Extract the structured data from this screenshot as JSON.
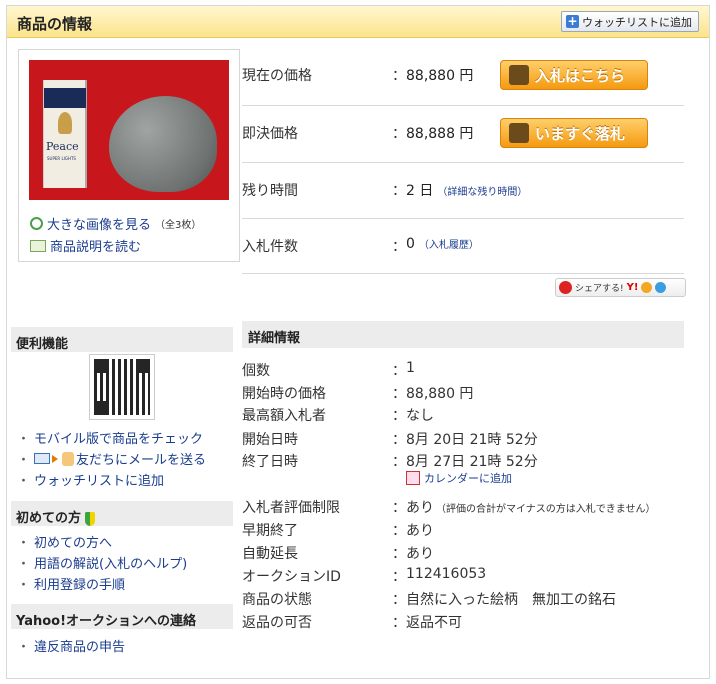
{
  "header": {
    "title": "商品の情報",
    "watch_button": "ウォッチリストに追加"
  },
  "image": {
    "pack_name": "Peace",
    "pack_sub": "SUPER LIGHTS",
    "view_large": "大きな画像を見る",
    "view_count": "（全3枚）",
    "read_description": "商品説明を読む"
  },
  "summary": {
    "current_price_label": "現在の価格",
    "current_price": "88,880 円",
    "bid_button": "入札はこちら",
    "buyout_label": "即決価格",
    "buyout_price": "88,888 円",
    "buyout_button": "いますぐ落札",
    "time_left_label": "残り時間",
    "time_left": "2 日",
    "time_left_link": "（詳細な残り時間）",
    "bids_label": "入札件数",
    "bids": "0",
    "bids_link": "（入札履歴）",
    "colon": "："
  },
  "share": {
    "label": "シェアする!",
    "yahoo": "Y!"
  },
  "sidebar": {
    "convenience_header": "便利機能",
    "convenience_items": [
      "モバイル版で商品をチェック",
      "友だちにメールを送る",
      "ウォッチリストに追加"
    ],
    "beginners_header": "初めての方",
    "beginners_items": [
      "初めての方へ",
      "用語の解説(入札のヘルプ)",
      "利用登録の手順"
    ],
    "contact_header": "Yahoo!オークションへの連絡",
    "contact_items": [
      "違反商品の申告"
    ],
    "bullet": "・"
  },
  "details": {
    "header": "詳細情報",
    "rows": [
      {
        "label": "個数",
        "value": "1"
      },
      {
        "label": "開始時の価格",
        "value": "88,880 円"
      },
      {
        "label": "最高額入札者",
        "value": "なし"
      },
      {
        "label": "開始日時",
        "value": "8月 20日 21時 52分"
      },
      {
        "label": "終了日時",
        "value": "8月 27日 21時 52分"
      },
      {
        "label": "入札者評価制限",
        "value": "あり",
        "note": "（評価の合計がマイナスの方は入札できません）"
      },
      {
        "label": "早期終了",
        "value": "あり"
      },
      {
        "label": "自動延長",
        "value": "あり"
      },
      {
        "label": "オークションID",
        "value": "112416053"
      },
      {
        "label": "商品の状態",
        "value": "自然に入った絵柄　無加工の銘石"
      },
      {
        "label": "返品の可否",
        "value": "返品不可"
      }
    ],
    "calendar_link": "カレンダーに追加"
  },
  "icons": [
    "plus-icon",
    "search-icon",
    "book-icon",
    "gavel-icon",
    "cart-icon",
    "share-icon",
    "qr-code",
    "mail-icon",
    "beginner-mark-icon",
    "calendar-icon"
  ]
}
